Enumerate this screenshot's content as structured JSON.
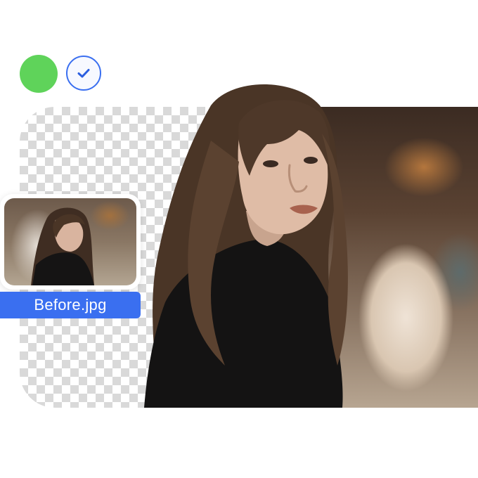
{
  "file": {
    "name": "Before.jpg"
  },
  "icons": {
    "status": "green-dot-icon",
    "check": "checkmark-icon"
  },
  "colors": {
    "accent": "#3a6ff0",
    "success": "#5fd35a",
    "checker": "#d9d9d9"
  }
}
